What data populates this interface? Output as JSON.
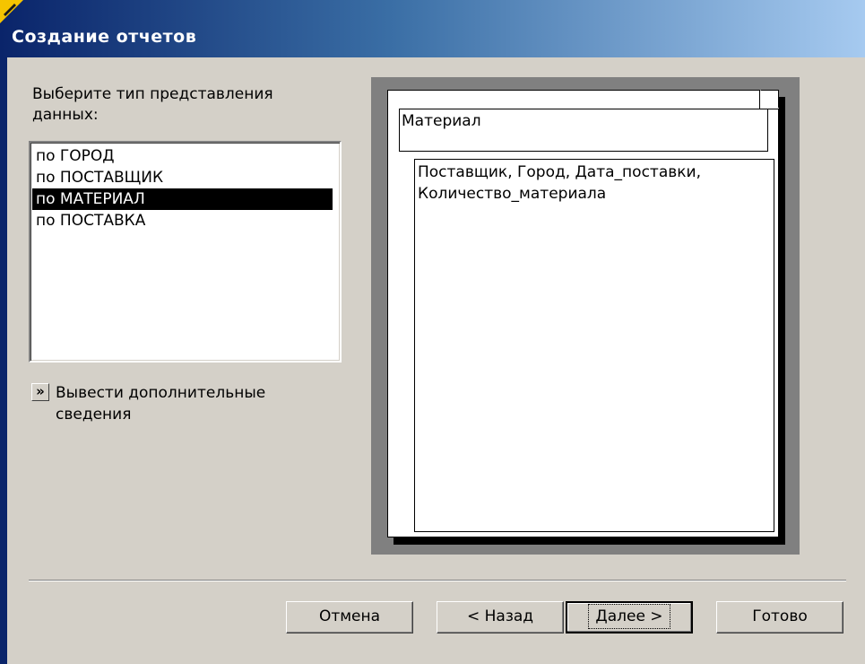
{
  "window": {
    "title": "Создание отчетов"
  },
  "prompt": "Выберите тип представления данных:",
  "list": {
    "items": [
      "по ГОРОД",
      "по ПОСТАВЩИК",
      "по МАТЕРИАЛ",
      "по ПОСТАВКА"
    ],
    "selected": "по МАТЕРИАЛ"
  },
  "more_details": {
    "button_glyph": "»",
    "label": "Вывести дополнительные сведения"
  },
  "preview": {
    "group_field": "Материал",
    "detail_fields": "Поставщик, Город, Дата_поставки, Количество_материала"
  },
  "buttons": {
    "cancel": "Отмена",
    "back": "< Назад",
    "next": "Далее >",
    "finish": "Готово"
  },
  "colors": {
    "titlebar_start": "#0a246a",
    "titlebar_end": "#a6caf0",
    "window_bg": "#d4d0c8",
    "selection_bg": "#000000"
  },
  "icons": {
    "corner": "corner-badge-icon"
  }
}
